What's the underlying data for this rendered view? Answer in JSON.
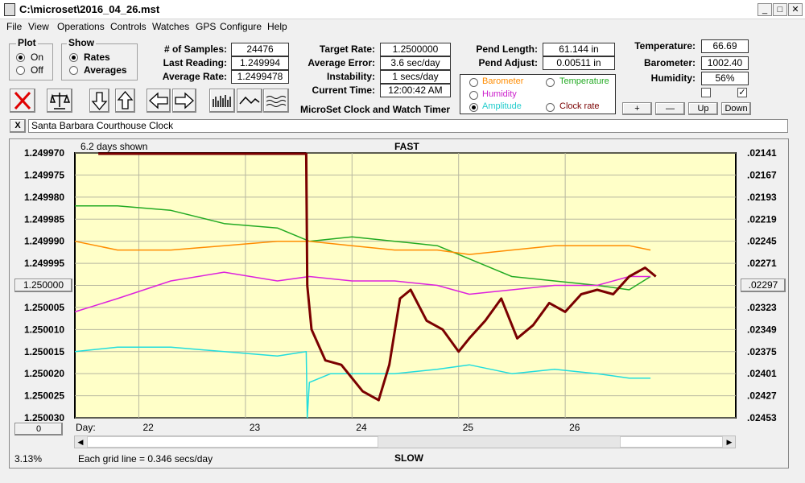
{
  "window": {
    "title": "C:\\microset\\2016_04_26.mst"
  },
  "menu": [
    "File",
    "View",
    "Operations",
    "Controls",
    "Watches",
    "GPS",
    "Configure",
    "Help"
  ],
  "plot_group": {
    "label": "Plot",
    "on": "On",
    "off": "Off",
    "selected": "On"
  },
  "show_group": {
    "label": "Show",
    "rates": "Rates",
    "averages": "Averages",
    "selected": "Rates"
  },
  "stats": {
    "samples_label": "# of Samples:",
    "samples": "24476",
    "last_label": "Last Reading:",
    "last": "1.249994",
    "avg_label": "Average Rate:",
    "avg": "1.2499478",
    "target_label": "Target Rate:",
    "target": "1.2500000",
    "avgerr_label": "Average Error:",
    "avgerr": "3.6 sec/day",
    "instab_label": "Instability:",
    "instab": "1 secs/day",
    "time_label": "Current Time:",
    "time": "12:00:42 AM",
    "pendlen_label": "Pend Length:",
    "pendlen": "61.144 in",
    "pendadj_label": "Pend Adjust:",
    "pendadj": "0.00511 in",
    "temp_label": "Temperature:",
    "temp": "66.69",
    "baro_label": "Barometer:",
    "baro": "1002.40",
    "hum_label": "Humidity:",
    "hum": "56%"
  },
  "app_caption": "MicroSet Clock and Watch Timer",
  "series_options": {
    "barometer": "Barometer",
    "temperature": "Temperature",
    "humidity": "Humidity",
    "amplitude": "Amplitude",
    "clock_rate": "Clock rate",
    "selected": "Amplitude"
  },
  "small_buttons": {
    "plus": "+",
    "minus": "—",
    "up": "Up",
    "down": "Down"
  },
  "checkboxes": {
    "left": false,
    "right": true
  },
  "clock_name": "Santa Barbara Courthouse Clock",
  "close_x": "X",
  "chart": {
    "days_shown": "6.2 days shown",
    "fast_label": "FAST",
    "slow_label": "SLOW",
    "day_label": "Day:",
    "center_left": "1.250000",
    "center_right": ".02297",
    "zero_button": "0",
    "zoom": "3.13%",
    "grid_note": "Each grid line = 0.346 secs/day"
  },
  "colors": {
    "barometer": "#ff8c00",
    "temperature": "#22aa22",
    "humidity": "#dd22dd",
    "amplitude": "#22dddd",
    "rate": "#7a0000",
    "plotbg": "#ffffc8"
  },
  "chart_data": {
    "type": "line",
    "x_unit": "day",
    "xlim": [
      21.4,
      27.6
    ],
    "x_ticks": [
      22,
      23,
      24,
      25,
      26
    ],
    "left_ticks": [
      "1.249970",
      "1.249975",
      "1.249980",
      "1.249985",
      "1.249990",
      "1.249995",
      "1.250000",
      "1.250005",
      "1.250010",
      "1.250015",
      "1.250020",
      "1.250025",
      "1.250030"
    ],
    "right_ticks": [
      ".02141",
      ".02167",
      ".02193",
      ".02219",
      ".02245",
      ".02271",
      ".02297",
      ".02323",
      ".02349",
      ".02375",
      ".02401",
      ".02427",
      ".02453"
    ],
    "series": [
      {
        "name": "Temperature",
        "x": [
          21.4,
          21.8,
          22.3,
          22.8,
          23.3,
          23.6,
          24.0,
          24.4,
          24.8,
          25.1,
          25.5,
          25.9,
          26.3,
          26.6,
          26.8
        ],
        "values": [
          1.249982,
          1.249982,
          1.249983,
          1.249986,
          1.249987,
          1.24999,
          1.249989,
          1.24999,
          1.249991,
          1.249994,
          1.249998,
          1.249999,
          1.25,
          1.250001,
          1.249998
        ]
      },
      {
        "name": "Barometer",
        "x": [
          21.4,
          21.8,
          22.3,
          22.8,
          23.3,
          23.6,
          24.0,
          24.4,
          24.8,
          25.1,
          25.5,
          25.9,
          26.3,
          26.6,
          26.8
        ],
        "values": [
          1.24999,
          1.249992,
          1.249992,
          1.249991,
          1.24999,
          1.24999,
          1.249991,
          1.249992,
          1.249992,
          1.249993,
          1.249992,
          1.249991,
          1.249991,
          1.249991,
          1.249992
        ]
      },
      {
        "name": "Humidity",
        "x": [
          21.4,
          21.8,
          22.3,
          22.8,
          23.3,
          23.6,
          24.0,
          24.4,
          24.8,
          25.1,
          25.5,
          25.9,
          26.3,
          26.6,
          26.8
        ],
        "values": [
          1.250006,
          1.250003,
          1.249999,
          1.249997,
          1.249999,
          1.249998,
          1.249999,
          1.249999,
          1.25,
          1.250002,
          1.250001,
          1.25,
          1.25,
          1.249998,
          1.249998
        ]
      },
      {
        "name": "Amplitude",
        "x": [
          21.4,
          21.8,
          22.3,
          22.8,
          23.3,
          23.57,
          23.58,
          23.6,
          23.8,
          24.0,
          24.4,
          24.8,
          25.1,
          25.5,
          25.9,
          26.3,
          26.6,
          26.8
        ],
        "values": [
          1.250015,
          1.250014,
          1.250014,
          1.250015,
          1.250016,
          1.250015,
          1.25003,
          1.250022,
          1.25002,
          1.25002,
          1.25002,
          1.250019,
          1.250018,
          1.25002,
          1.250019,
          1.25002,
          1.250021,
          1.250021
        ]
      },
      {
        "name": "Clock rate",
        "x": [
          23.57,
          23.58,
          23.62,
          23.75,
          23.9,
          24.1,
          24.25,
          24.35,
          24.45,
          24.55,
          24.7,
          24.85,
          25.0,
          25.1,
          25.25,
          25.4,
          25.55,
          25.7,
          25.85,
          26.0,
          26.15,
          26.3,
          26.45,
          26.6,
          26.75,
          26.85
        ],
        "values": [
          1.24997,
          1.25,
          1.25001,
          1.250017,
          1.250018,
          1.250024,
          1.250026,
          1.250018,
          1.250003,
          1.250001,
          1.250008,
          1.25001,
          1.250015,
          1.250012,
          1.250008,
          1.250003,
          1.250012,
          1.250009,
          1.250004,
          1.250006,
          1.250002,
          1.250001,
          1.250002,
          1.249998,
          1.249996,
          1.249998
        ]
      }
    ]
  }
}
